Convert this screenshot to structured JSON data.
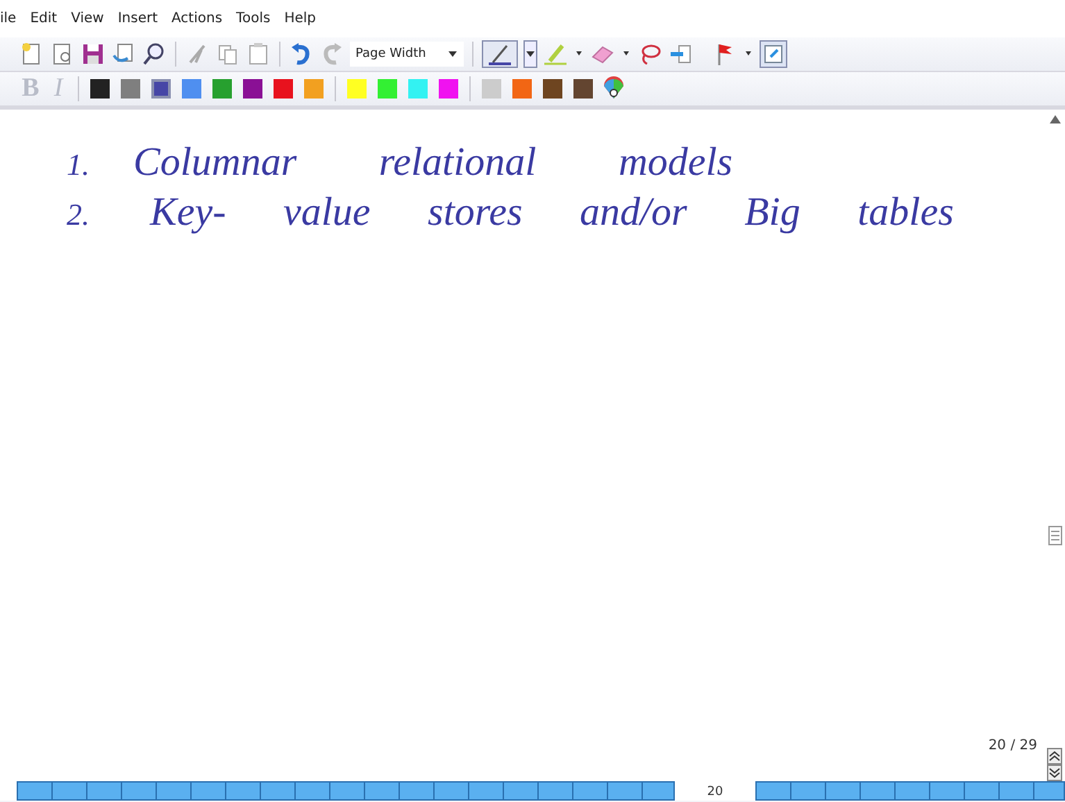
{
  "menu": [
    "ile",
    "Edit",
    "View",
    "Insert",
    "Actions",
    "Tools",
    "Help"
  ],
  "zoom": {
    "value": "Page Width"
  },
  "format_buttons": [
    "B",
    "I"
  ],
  "palette": [
    {
      "color": "#222222",
      "selected": false
    },
    {
      "color": "#7f7f7f",
      "selected": false
    },
    {
      "color": "#4646a6",
      "selected": true
    },
    {
      "color": "#4f8ff0",
      "selected": false
    },
    {
      "color": "#27a02f",
      "selected": false
    },
    {
      "color": "#8a1095",
      "selected": false
    },
    {
      "color": "#e8121e",
      "selected": false
    },
    {
      "color": "#f2a020",
      "selected": false
    },
    {
      "color": "#ffff22",
      "selected": false
    },
    {
      "color": "#33f033",
      "selected": false
    },
    {
      "color": "#33f2f2",
      "selected": false
    },
    {
      "color": "#f012f0",
      "selected": false
    },
    {
      "color": "#cccccc",
      "selected": false
    },
    {
      "color": "#f26614",
      "selected": false
    },
    {
      "color": "#6e4520",
      "selected": false
    },
    {
      "color": "#634530",
      "selected": false
    }
  ],
  "notes": [
    {
      "number": "1.",
      "text": "Columnar relational models"
    },
    {
      "number": "2.",
      "text": "Key- value stores and/or Big tables"
    }
  ],
  "page_counter": "20 / 29",
  "page_strip": {
    "current": "20"
  }
}
